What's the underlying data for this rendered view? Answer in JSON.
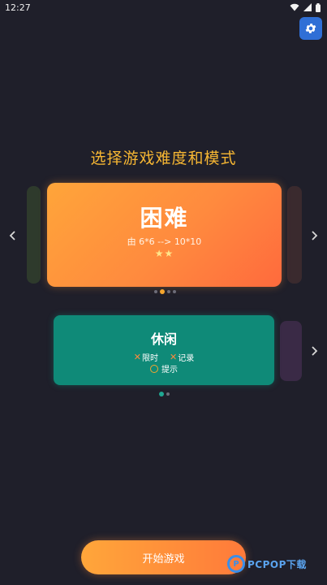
{
  "status_bar": {
    "time": "12:27",
    "icons": [
      "wifi-icon",
      "signal-icon",
      "battery-icon"
    ]
  },
  "settings": {
    "icon": "gear-icon"
  },
  "title": "选择游戏难度和模式",
  "difficulty": {
    "name": "困难",
    "range": "由 6*6 --> 10*10",
    "stars": "★★",
    "star_count": 2,
    "page_count": 4,
    "active_page": 1
  },
  "mode": {
    "name": "休闲",
    "options": [
      {
        "mark": "✕",
        "label": "限时"
      },
      {
        "mark": "✕",
        "label": "记录"
      }
    ],
    "hint_label": "提示",
    "page_count": 2,
    "active_page": 0
  },
  "start_button": "开始游戏",
  "watermark": {
    "logo": "P",
    "text": "PCPOP下载"
  },
  "colors": {
    "background": "#1f1f2a",
    "title": "#f7b733",
    "difficulty_card": "#ff8a3e",
    "mode_card": "#0f8a78",
    "settings_button": "#2f6fd6"
  }
}
